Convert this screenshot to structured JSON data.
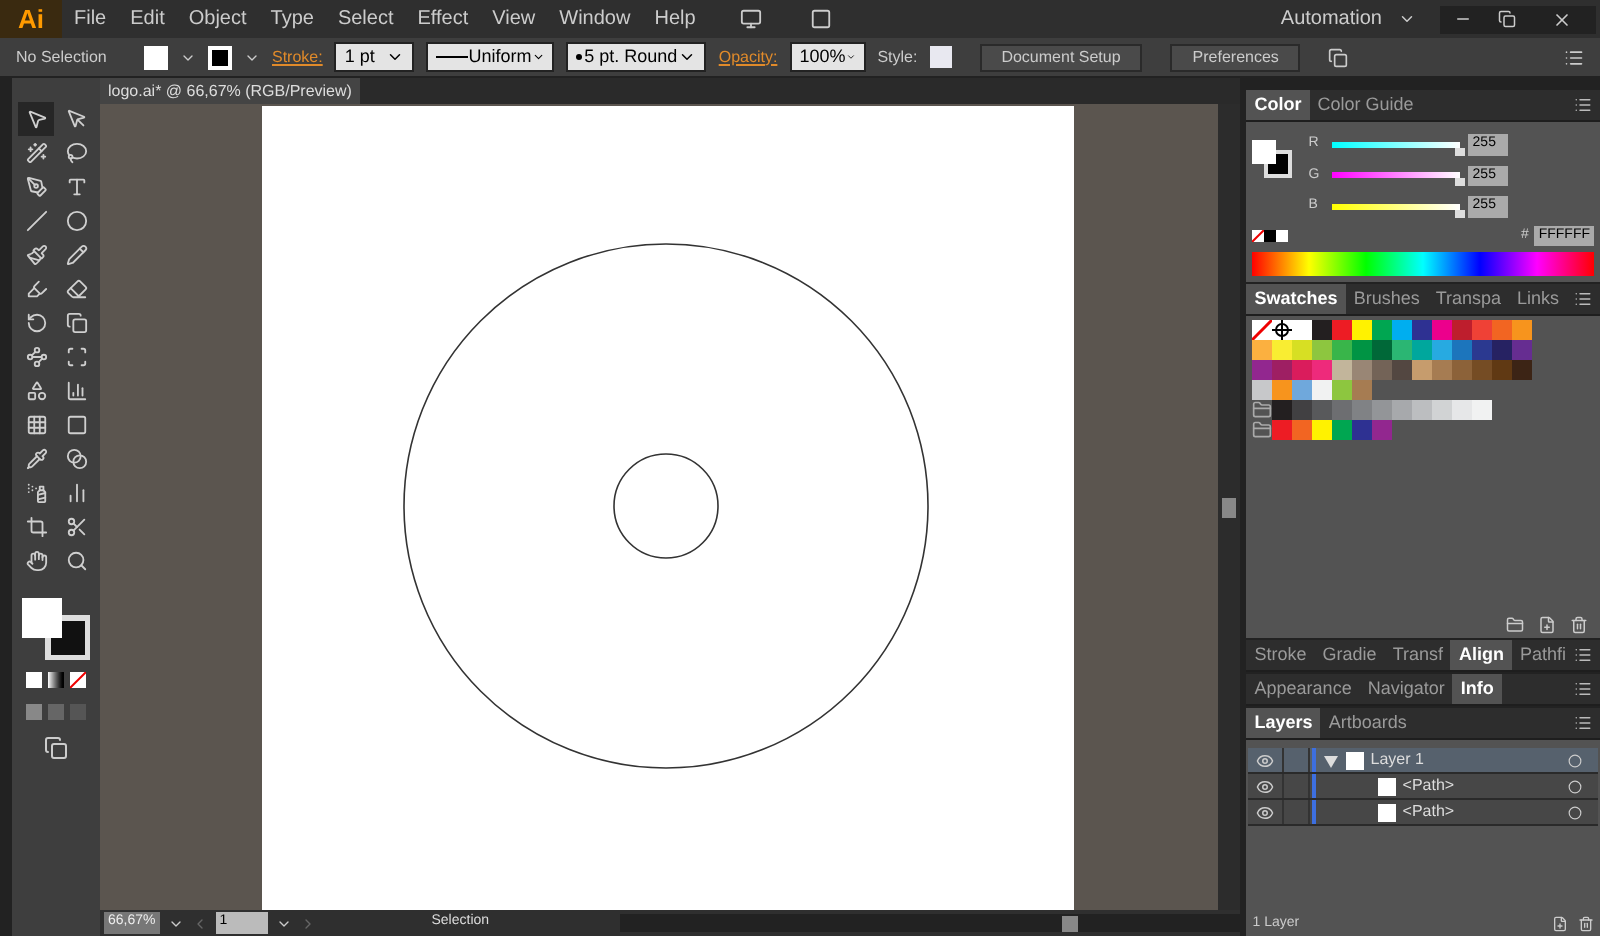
{
  "app": {
    "logo": "Ai",
    "menus": [
      "File",
      "Edit",
      "Object",
      "Type",
      "Select",
      "Effect",
      "View",
      "Window",
      "Help"
    ],
    "workspace": "Automation"
  },
  "control_bar": {
    "selection": "No Selection",
    "stroke_label": "Stroke:",
    "stroke_weight": "1 pt",
    "profile": "Uniform",
    "brush": "5 pt. Round",
    "opacity_label": "Opacity:",
    "opacity": "100%",
    "style_label": "Style:",
    "buttons": [
      "Document Setup",
      "Preferences"
    ]
  },
  "tools": [
    {
      "selected": true
    },
    {
      "selected": false
    },
    {
      "selected": false
    },
    {
      "selected": false
    },
    {
      "selected": false
    },
    {
      "selected": false
    },
    {
      "selected": false
    },
    {
      "selected": false
    },
    {
      "selected": false
    },
    {
      "selected": false
    },
    {
      "selected": false
    },
    {
      "selected": false
    },
    {
      "selected": false
    },
    {
      "selected": false
    },
    {
      "selected": false
    },
    {
      "selected": false
    },
    {
      "selected": false
    },
    {
      "selected": false
    },
    {
      "selected": false
    },
    {
      "selected": false
    },
    {
      "selected": false
    },
    {
      "selected": false
    },
    {
      "selected": false
    },
    {
      "selected": false
    },
    {
      "selected": false
    },
    {
      "selected": false
    },
    {
      "selected": false
    },
    {
      "selected": false
    }
  ],
  "document": {
    "tab": "logo.ai* @ 66,67% (RGB/Preview)"
  },
  "color_panel": {
    "tabs": [
      {
        "label": "Color",
        "selected": true
      },
      {
        "label": "Color Guide",
        "selected": false
      }
    ],
    "channels": [
      {
        "name": "R",
        "value": "255",
        "level": 1
      },
      {
        "name": "G",
        "value": "255",
        "level": 1
      },
      {
        "name": "B",
        "value": "255",
        "level": 1
      }
    ],
    "hash": "#",
    "hex": "FFFFFF"
  },
  "swatches_panel": {
    "tabs": [
      {
        "label": "Swatches",
        "selected": true
      },
      {
        "label": "Brushes",
        "selected": false
      },
      {
        "label": "Transpa",
        "selected": false
      },
      {
        "label": "Links",
        "selected": false
      }
    ],
    "rows": [
      [
        {
          "kind": "none"
        },
        {
          "kind": "registration"
        },
        {
          "kind": "color",
          "color": "#ffffff"
        },
        {
          "kind": "color",
          "color": "#231f20"
        },
        {
          "kind": "color",
          "color": "#ed1c24"
        },
        {
          "kind": "color",
          "color": "#fff200"
        },
        {
          "kind": "color",
          "color": "#00a651"
        },
        {
          "kind": "color",
          "color": "#00aeef"
        },
        {
          "kind": "color",
          "color": "#2e3192"
        },
        {
          "kind": "color",
          "color": "#ec008c"
        },
        {
          "kind": "color",
          "color": "#be1e2d"
        },
        {
          "kind": "color",
          "color": "#ef4136"
        },
        {
          "kind": "color",
          "color": "#f26522"
        },
        {
          "kind": "color",
          "color": "#f7941d"
        }
      ],
      [
        {
          "kind": "color",
          "color": "#fbb040"
        },
        {
          "kind": "color",
          "color": "#f9ed32"
        },
        {
          "kind": "color",
          "color": "#d7df23"
        },
        {
          "kind": "color",
          "color": "#8dc63f"
        },
        {
          "kind": "color",
          "color": "#39b54a"
        },
        {
          "kind": "color",
          "color": "#009444"
        },
        {
          "kind": "color",
          "color": "#006838"
        },
        {
          "kind": "color",
          "color": "#2bb673"
        },
        {
          "kind": "color",
          "color": "#00a79d"
        },
        {
          "kind": "color",
          "color": "#27aae1"
        },
        {
          "kind": "color",
          "color": "#1c75bc"
        },
        {
          "kind": "color",
          "color": "#2b3990"
        },
        {
          "kind": "color",
          "color": "#262262"
        },
        {
          "kind": "color",
          "color": "#662d91"
        }
      ],
      [
        {
          "kind": "color",
          "color": "#92278f"
        },
        {
          "kind": "color",
          "color": "#9e1f63"
        },
        {
          "kind": "color",
          "color": "#da1c5c"
        },
        {
          "kind": "color",
          "color": "#ee2a7b"
        },
        {
          "kind": "color",
          "color": "#c2b59b"
        },
        {
          "kind": "color",
          "color": "#998675"
        },
        {
          "kind": "color",
          "color": "#736357"
        },
        {
          "kind": "color",
          "color": "#534741"
        },
        {
          "kind": "color",
          "color": "#c69c6d"
        },
        {
          "kind": "color",
          "color": "#a67c52"
        },
        {
          "kind": "color",
          "color": "#8c6239"
        },
        {
          "kind": "color",
          "color": "#754c24"
        },
        {
          "kind": "color",
          "color": "#603913"
        },
        {
          "kind": "color",
          "color": "#3c2415"
        }
      ],
      [
        {
          "kind": "color",
          "color": "#c7c8ca"
        },
        {
          "kind": "color",
          "color": "#f7941d"
        },
        {
          "kind": "color",
          "color": "#6fa8dc"
        },
        {
          "kind": "color",
          "color": "#f1f2f2"
        },
        {
          "kind": "color",
          "color": "#8dc63f"
        },
        {
          "kind": "color",
          "color": "#a67c52"
        }
      ],
      [
        {
          "kind": "folder"
        },
        {
          "kind": "color",
          "color": "#231f20"
        },
        {
          "kind": "color",
          "color": "#414042"
        },
        {
          "kind": "color",
          "color": "#58595b"
        },
        {
          "kind": "color",
          "color": "#6d6e71"
        },
        {
          "kind": "color",
          "color": "#808285"
        },
        {
          "kind": "color",
          "color": "#939598"
        },
        {
          "kind": "color",
          "color": "#a7a9ac"
        },
        {
          "kind": "color",
          "color": "#bcbec0"
        },
        {
          "kind": "color",
          "color": "#d1d3d4"
        },
        {
          "kind": "color",
          "color": "#e6e7e8"
        },
        {
          "kind": "color",
          "color": "#f1f2f2"
        }
      ],
      [
        {
          "kind": "folder"
        },
        {
          "kind": "color",
          "color": "#ed1c24"
        },
        {
          "kind": "color",
          "color": "#f26522"
        },
        {
          "kind": "color",
          "color": "#fff200"
        },
        {
          "kind": "color",
          "color": "#00a651"
        },
        {
          "kind": "color",
          "color": "#2e3192"
        },
        {
          "kind": "color",
          "color": "#92278f"
        }
      ]
    ]
  },
  "tab_groups": [
    [
      {
        "label": "Stroke",
        "selected": false
      },
      {
        "label": "Gradie",
        "selected": false
      },
      {
        "label": "Transf",
        "selected": false
      },
      {
        "label": "Align",
        "selected": true
      },
      {
        "label": "Pathfi",
        "selected": false
      }
    ],
    [
      {
        "label": "Appearance",
        "selected": false
      },
      {
        "label": "Navigator",
        "selected": false
      },
      {
        "label": "Info",
        "selected": true
      }
    ]
  ],
  "layers_panel": {
    "tabs": [
      {
        "label": "Layers",
        "selected": true
      },
      {
        "label": "Artboards",
        "selected": false
      }
    ],
    "layers": [
      {
        "name": "Layer 1",
        "color": "#3d6fe0",
        "selected": true,
        "expanded": true,
        "children": [
          {
            "name": "<Path>"
          },
          {
            "name": "<Path>"
          }
        ]
      }
    ],
    "footer": "1 Layer"
  },
  "status_bar": {
    "zoom": "66,67%",
    "page": "1",
    "tool": "Selection"
  }
}
